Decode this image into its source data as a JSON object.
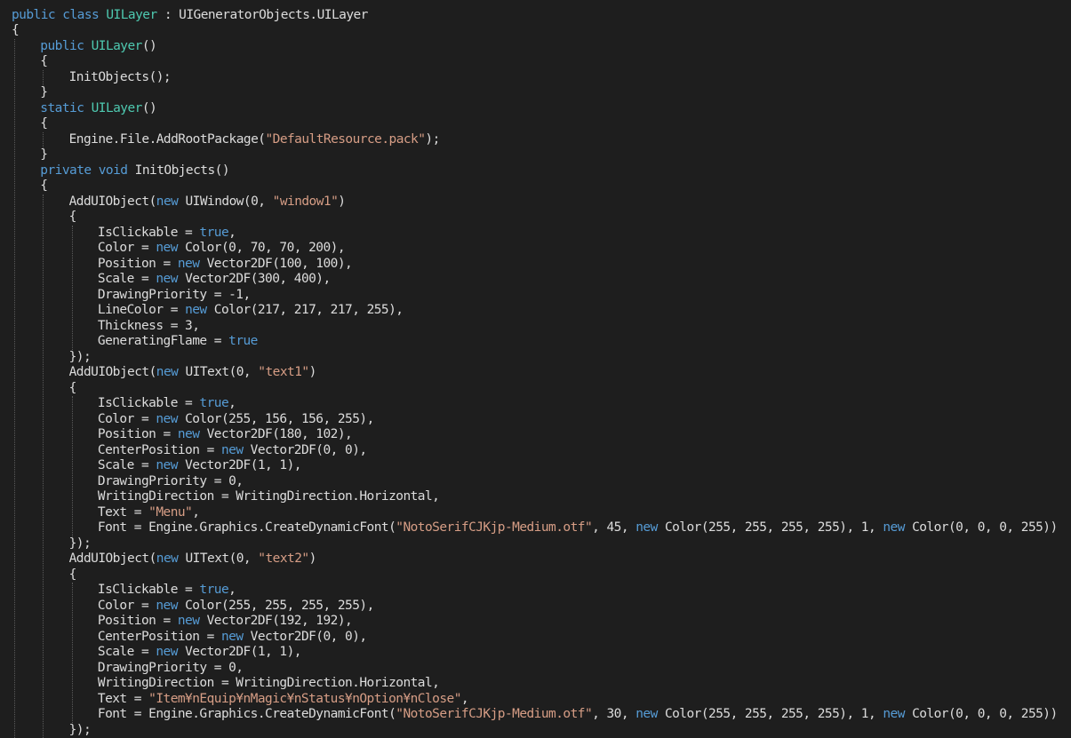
{
  "editor": {
    "theme_colors": {
      "background": "#1e1e1e",
      "keyword": "#569cd6",
      "type": "#4ec9b0",
      "string": "#d69d85",
      "text": "#dcdcdc",
      "guide": "#5a5a5a"
    },
    "lines": [
      {
        "indent": 0,
        "tokens": [
          [
            "kw",
            "public"
          ],
          [
            "plain",
            " "
          ],
          [
            "kw",
            "class"
          ],
          [
            "plain",
            " "
          ],
          [
            "type",
            "UILayer"
          ],
          [
            "plain",
            " : UIGeneratorObjects.UILayer"
          ]
        ]
      },
      {
        "indent": 0,
        "tokens": [
          [
            "plain",
            "{"
          ]
        ]
      },
      {
        "indent": 1,
        "tokens": [
          [
            "kw",
            "public"
          ],
          [
            "plain",
            " "
          ],
          [
            "type",
            "UILayer"
          ],
          [
            "plain",
            "()"
          ]
        ]
      },
      {
        "indent": 1,
        "tokens": [
          [
            "plain",
            "{"
          ]
        ]
      },
      {
        "indent": 2,
        "tokens": [
          [
            "plain",
            "InitObjects();"
          ]
        ]
      },
      {
        "indent": 1,
        "tokens": [
          [
            "plain",
            "}"
          ]
        ]
      },
      {
        "indent": 1,
        "tokens": [
          [
            "kw",
            "static"
          ],
          [
            "plain",
            " "
          ],
          [
            "type",
            "UILayer"
          ],
          [
            "plain",
            "()"
          ]
        ]
      },
      {
        "indent": 1,
        "tokens": [
          [
            "plain",
            "{"
          ]
        ]
      },
      {
        "indent": 2,
        "tokens": [
          [
            "plain",
            "Engine.File.AddRootPackage("
          ],
          [
            "str",
            "\"DefaultResource.pack\""
          ],
          [
            "plain",
            ");"
          ]
        ]
      },
      {
        "indent": 1,
        "tokens": [
          [
            "plain",
            "}"
          ]
        ]
      },
      {
        "indent": 1,
        "tokens": [
          [
            "kw",
            "private"
          ],
          [
            "plain",
            " "
          ],
          [
            "kw",
            "void"
          ],
          [
            "plain",
            " InitObjects()"
          ]
        ]
      },
      {
        "indent": 1,
        "tokens": [
          [
            "plain",
            "{"
          ]
        ]
      },
      {
        "indent": 2,
        "tokens": [
          [
            "plain",
            "AddUIObject("
          ],
          [
            "kw",
            "new"
          ],
          [
            "plain",
            " UIWindow(0, "
          ],
          [
            "str",
            "\"window1\""
          ],
          [
            "plain",
            ")"
          ]
        ]
      },
      {
        "indent": 2,
        "tokens": [
          [
            "plain",
            "{"
          ]
        ]
      },
      {
        "indent": 3,
        "tokens": [
          [
            "plain",
            "IsClickable = "
          ],
          [
            "kw",
            "true"
          ],
          [
            "plain",
            ","
          ]
        ]
      },
      {
        "indent": 3,
        "tokens": [
          [
            "plain",
            "Color = "
          ],
          [
            "kw",
            "new"
          ],
          [
            "plain",
            " Color(0, 70, 70, 200),"
          ]
        ]
      },
      {
        "indent": 3,
        "tokens": [
          [
            "plain",
            "Position = "
          ],
          [
            "kw",
            "new"
          ],
          [
            "plain",
            " Vector2DF(100, 100),"
          ]
        ]
      },
      {
        "indent": 3,
        "tokens": [
          [
            "plain",
            "Scale = "
          ],
          [
            "kw",
            "new"
          ],
          [
            "plain",
            " Vector2DF(300, 400),"
          ]
        ]
      },
      {
        "indent": 3,
        "tokens": [
          [
            "plain",
            "DrawingPriority = -1,"
          ]
        ]
      },
      {
        "indent": 3,
        "tokens": [
          [
            "plain",
            "LineColor = "
          ],
          [
            "kw",
            "new"
          ],
          [
            "plain",
            " Color(217, 217, 217, 255),"
          ]
        ]
      },
      {
        "indent": 3,
        "tokens": [
          [
            "plain",
            "Thickness = 3,"
          ]
        ]
      },
      {
        "indent": 3,
        "tokens": [
          [
            "plain",
            "GeneratingFlame = "
          ],
          [
            "kw",
            "true"
          ]
        ]
      },
      {
        "indent": 2,
        "tokens": [
          [
            "plain",
            "});"
          ]
        ]
      },
      {
        "indent": 2,
        "tokens": [
          [
            "plain",
            "AddUIObject("
          ],
          [
            "kw",
            "new"
          ],
          [
            "plain",
            " UIText(0, "
          ],
          [
            "str",
            "\"text1\""
          ],
          [
            "plain",
            ")"
          ]
        ]
      },
      {
        "indent": 2,
        "tokens": [
          [
            "plain",
            "{"
          ]
        ]
      },
      {
        "indent": 3,
        "tokens": [
          [
            "plain",
            "IsClickable = "
          ],
          [
            "kw",
            "true"
          ],
          [
            "plain",
            ","
          ]
        ]
      },
      {
        "indent": 3,
        "tokens": [
          [
            "plain",
            "Color = "
          ],
          [
            "kw",
            "new"
          ],
          [
            "plain",
            " Color(255, 156, 156, 255),"
          ]
        ]
      },
      {
        "indent": 3,
        "tokens": [
          [
            "plain",
            "Position = "
          ],
          [
            "kw",
            "new"
          ],
          [
            "plain",
            " Vector2DF(180, 102),"
          ]
        ]
      },
      {
        "indent": 3,
        "tokens": [
          [
            "plain",
            "CenterPosition = "
          ],
          [
            "kw",
            "new"
          ],
          [
            "plain",
            " Vector2DF(0, 0),"
          ]
        ]
      },
      {
        "indent": 3,
        "tokens": [
          [
            "plain",
            "Scale = "
          ],
          [
            "kw",
            "new"
          ],
          [
            "plain",
            " Vector2DF(1, 1),"
          ]
        ]
      },
      {
        "indent": 3,
        "tokens": [
          [
            "plain",
            "DrawingPriority = 0,"
          ]
        ]
      },
      {
        "indent": 3,
        "tokens": [
          [
            "plain",
            "WritingDirection = WritingDirection.Horizontal,"
          ]
        ]
      },
      {
        "indent": 3,
        "tokens": [
          [
            "plain",
            "Text = "
          ],
          [
            "str",
            "\"Menu\""
          ],
          [
            "plain",
            ","
          ]
        ]
      },
      {
        "indent": 3,
        "tokens": [
          [
            "plain",
            "Font = Engine.Graphics.CreateDynamicFont("
          ],
          [
            "str",
            "\"NotoSerifCJKjp-Medium.otf\""
          ],
          [
            "plain",
            ", 45, "
          ],
          [
            "kw",
            "new"
          ],
          [
            "plain",
            " Color(255, 255, 255, 255), 1, "
          ],
          [
            "kw",
            "new"
          ],
          [
            "plain",
            " Color(0, 0, 0, 255))"
          ]
        ]
      },
      {
        "indent": 2,
        "tokens": [
          [
            "plain",
            "});"
          ]
        ]
      },
      {
        "indent": 2,
        "tokens": [
          [
            "plain",
            "AddUIObject("
          ],
          [
            "kw",
            "new"
          ],
          [
            "plain",
            " UIText(0, "
          ],
          [
            "str",
            "\"text2\""
          ],
          [
            "plain",
            ")"
          ]
        ]
      },
      {
        "indent": 2,
        "tokens": [
          [
            "plain",
            "{"
          ]
        ]
      },
      {
        "indent": 3,
        "tokens": [
          [
            "plain",
            "IsClickable = "
          ],
          [
            "kw",
            "true"
          ],
          [
            "plain",
            ","
          ]
        ]
      },
      {
        "indent": 3,
        "tokens": [
          [
            "plain",
            "Color = "
          ],
          [
            "kw",
            "new"
          ],
          [
            "plain",
            " Color(255, 255, 255, 255),"
          ]
        ]
      },
      {
        "indent": 3,
        "tokens": [
          [
            "plain",
            "Position = "
          ],
          [
            "kw",
            "new"
          ],
          [
            "plain",
            " Vector2DF(192, 192),"
          ]
        ]
      },
      {
        "indent": 3,
        "tokens": [
          [
            "plain",
            "CenterPosition = "
          ],
          [
            "kw",
            "new"
          ],
          [
            "plain",
            " Vector2DF(0, 0),"
          ]
        ]
      },
      {
        "indent": 3,
        "tokens": [
          [
            "plain",
            "Scale = "
          ],
          [
            "kw",
            "new"
          ],
          [
            "plain",
            " Vector2DF(1, 1),"
          ]
        ]
      },
      {
        "indent": 3,
        "tokens": [
          [
            "plain",
            "DrawingPriority = 0,"
          ]
        ]
      },
      {
        "indent": 3,
        "tokens": [
          [
            "plain",
            "WritingDirection = WritingDirection.Horizontal,"
          ]
        ]
      },
      {
        "indent": 3,
        "tokens": [
          [
            "plain",
            "Text = "
          ],
          [
            "str",
            "\"Item¥nEquip¥nMagic¥nStatus¥nOption¥nClose\""
          ],
          [
            "plain",
            ","
          ]
        ]
      },
      {
        "indent": 3,
        "tokens": [
          [
            "plain",
            "Font = Engine.Graphics.CreateDynamicFont("
          ],
          [
            "str",
            "\"NotoSerifCJKjp-Medium.otf\""
          ],
          [
            "plain",
            ", 30, "
          ],
          [
            "kw",
            "new"
          ],
          [
            "plain",
            " Color(255, 255, 255, 255), 1, "
          ],
          [
            "kw",
            "new"
          ],
          [
            "plain",
            " Color(0, 0, 0, 255))"
          ]
        ]
      },
      {
        "indent": 2,
        "tokens": [
          [
            "plain",
            "});"
          ]
        ]
      }
    ]
  }
}
